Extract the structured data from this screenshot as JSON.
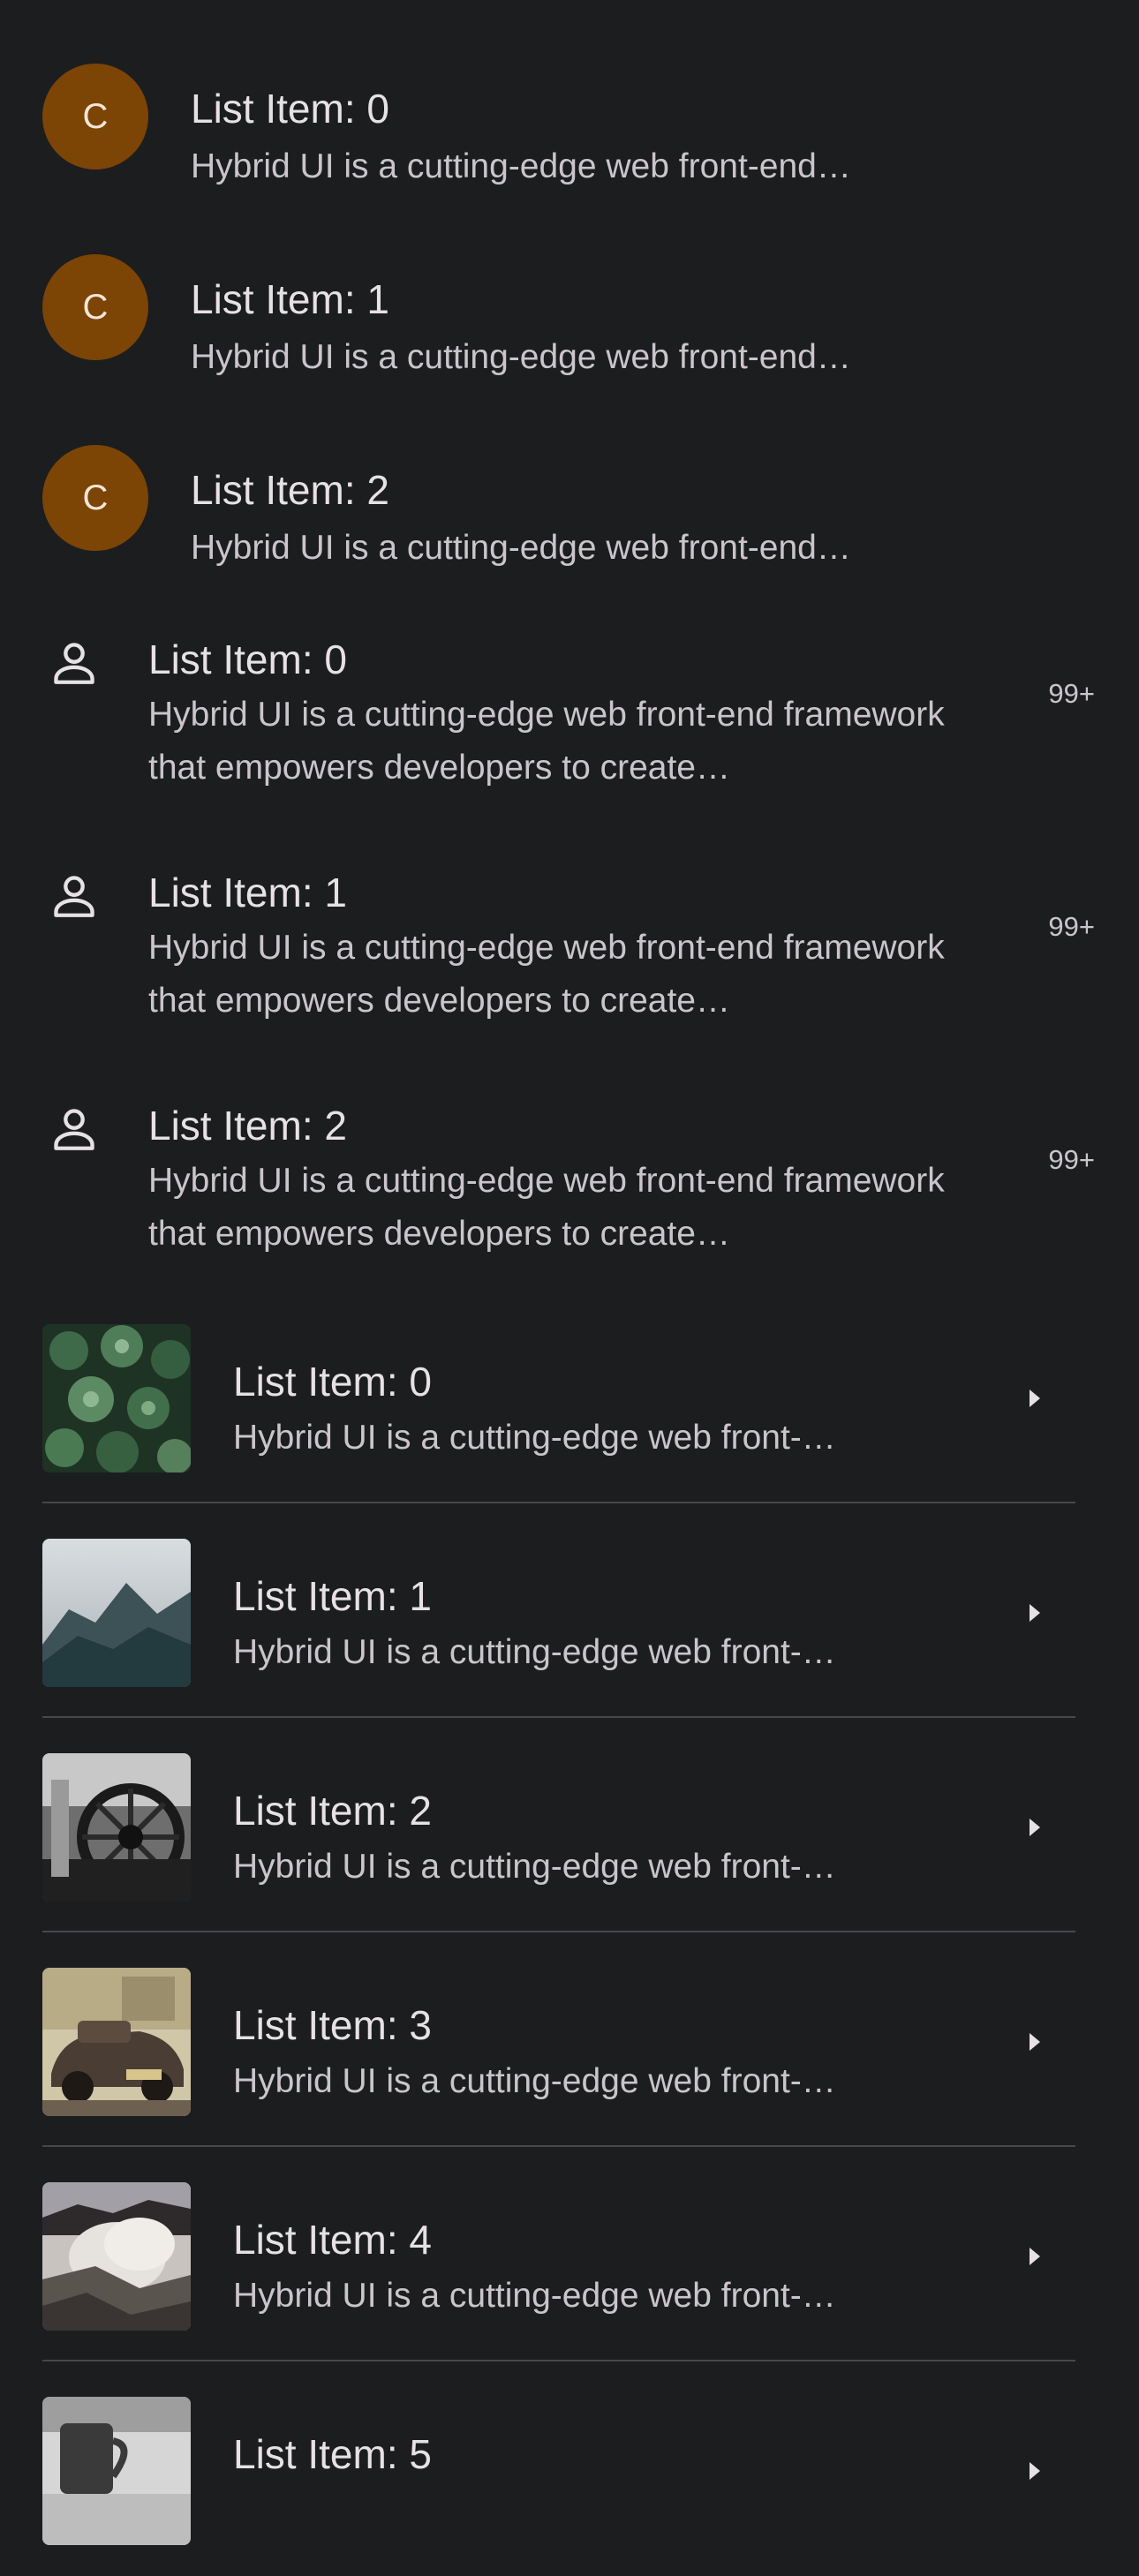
{
  "avatar_list": {
    "items": [
      {
        "initial": "C",
        "title": "List Item: 0",
        "subtitle": "Hybrid UI is a cutting-edge web front-end…"
      },
      {
        "initial": "C",
        "title": "List Item: 1",
        "subtitle": "Hybrid UI is a cutting-edge web front-end…"
      },
      {
        "initial": "C",
        "title": "List Item: 2",
        "subtitle": "Hybrid UI is a cutting-edge web front-end…"
      }
    ],
    "avatar_color": "#7c4405"
  },
  "person_list": {
    "items": [
      {
        "icon": "person-icon",
        "title": "List Item: 0",
        "subtitle": "Hybrid UI is a cutting-edge web front-end framework that empowers developers to create…",
        "badge": "99+"
      },
      {
        "icon": "person-icon",
        "title": "List Item: 1",
        "subtitle": "Hybrid UI is a cutting-edge web front-end framework that empowers developers to create…",
        "badge": "99+"
      },
      {
        "icon": "person-icon",
        "title": "List Item: 2",
        "subtitle": "Hybrid UI is a cutting-edge web front-end framework that empowers developers to create…",
        "badge": "99+"
      }
    ]
  },
  "image_list": {
    "items": [
      {
        "image": "succulent-plants-photo",
        "title": "List Item: 0",
        "subtitle": "Hybrid UI is a cutting-edge web front-…"
      },
      {
        "image": "misty-mountain-photo",
        "title": "List Item: 1",
        "subtitle": "Hybrid UI is a cutting-edge web front-…"
      },
      {
        "image": "old-wagon-wheel-photo",
        "title": "List Item: 2",
        "subtitle": "Hybrid UI is a cutting-edge web front-…"
      },
      {
        "image": "vintage-car-photo",
        "title": "List Item: 3",
        "subtitle": "Hybrid UI is a cutting-edge web front-…"
      },
      {
        "image": "steaming-hot-spring-photo",
        "title": "List Item: 4",
        "subtitle": "Hybrid UI is a cutting-edge web front-…"
      },
      {
        "image": "mug-on-desk-photo",
        "title": "List Item: 5",
        "subtitle": ""
      }
    ]
  }
}
